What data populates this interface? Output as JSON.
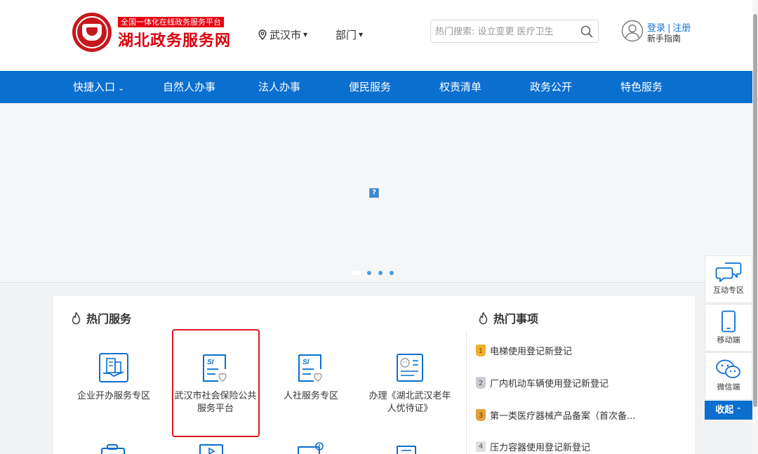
{
  "header": {
    "logo_top": "全国一体化在线政务服务平台",
    "logo_title": "湖北政务服务网",
    "city": "武汉市",
    "dept": "部门",
    "search_placeholder": "热门搜索: 设立变更 医疗卫生",
    "login": "登录",
    "register": "注册",
    "login_sep": "|",
    "guide": "新手指南"
  },
  "nav": {
    "items": [
      "快捷入口",
      "自然人办事",
      "法人办事",
      "便民服务",
      "权责清单",
      "政务公开",
      "特色服务"
    ]
  },
  "banner": {
    "broken_image": "?",
    "slide_count": 4,
    "active_slide": 1
  },
  "hot_services": {
    "title": "热门服务",
    "items": [
      {
        "label_line1": "企业开办服务专区",
        "label_line2": ""
      },
      {
        "label_line1": "武汉市社会保险公共",
        "label_line2": "服务平台"
      },
      {
        "label_line1": "人社服务专区",
        "label_line2": ""
      },
      {
        "label_line1": "办理《湖北武汉老年",
        "label_line2": "人优待证》"
      }
    ]
  },
  "hot_matters": {
    "title": "热门事项",
    "items": [
      {
        "rank": "1",
        "label": "电梯使用登记新登记"
      },
      {
        "rank": "2",
        "label": "厂内机动车辆使用登记新登记"
      },
      {
        "rank": "3",
        "label": "第一类医疗器械产品备案（首次备..."
      },
      {
        "rank": "4",
        "label": "压力容器使用登记新登记"
      }
    ]
  },
  "floating": {
    "items": [
      "互动专区",
      "移动端",
      "微信端"
    ],
    "collapse": "收起"
  },
  "colors": {
    "brand_blue": "#0b6fd0",
    "brand_red": "#d7000f",
    "highlight_red": "#e0191e"
  }
}
